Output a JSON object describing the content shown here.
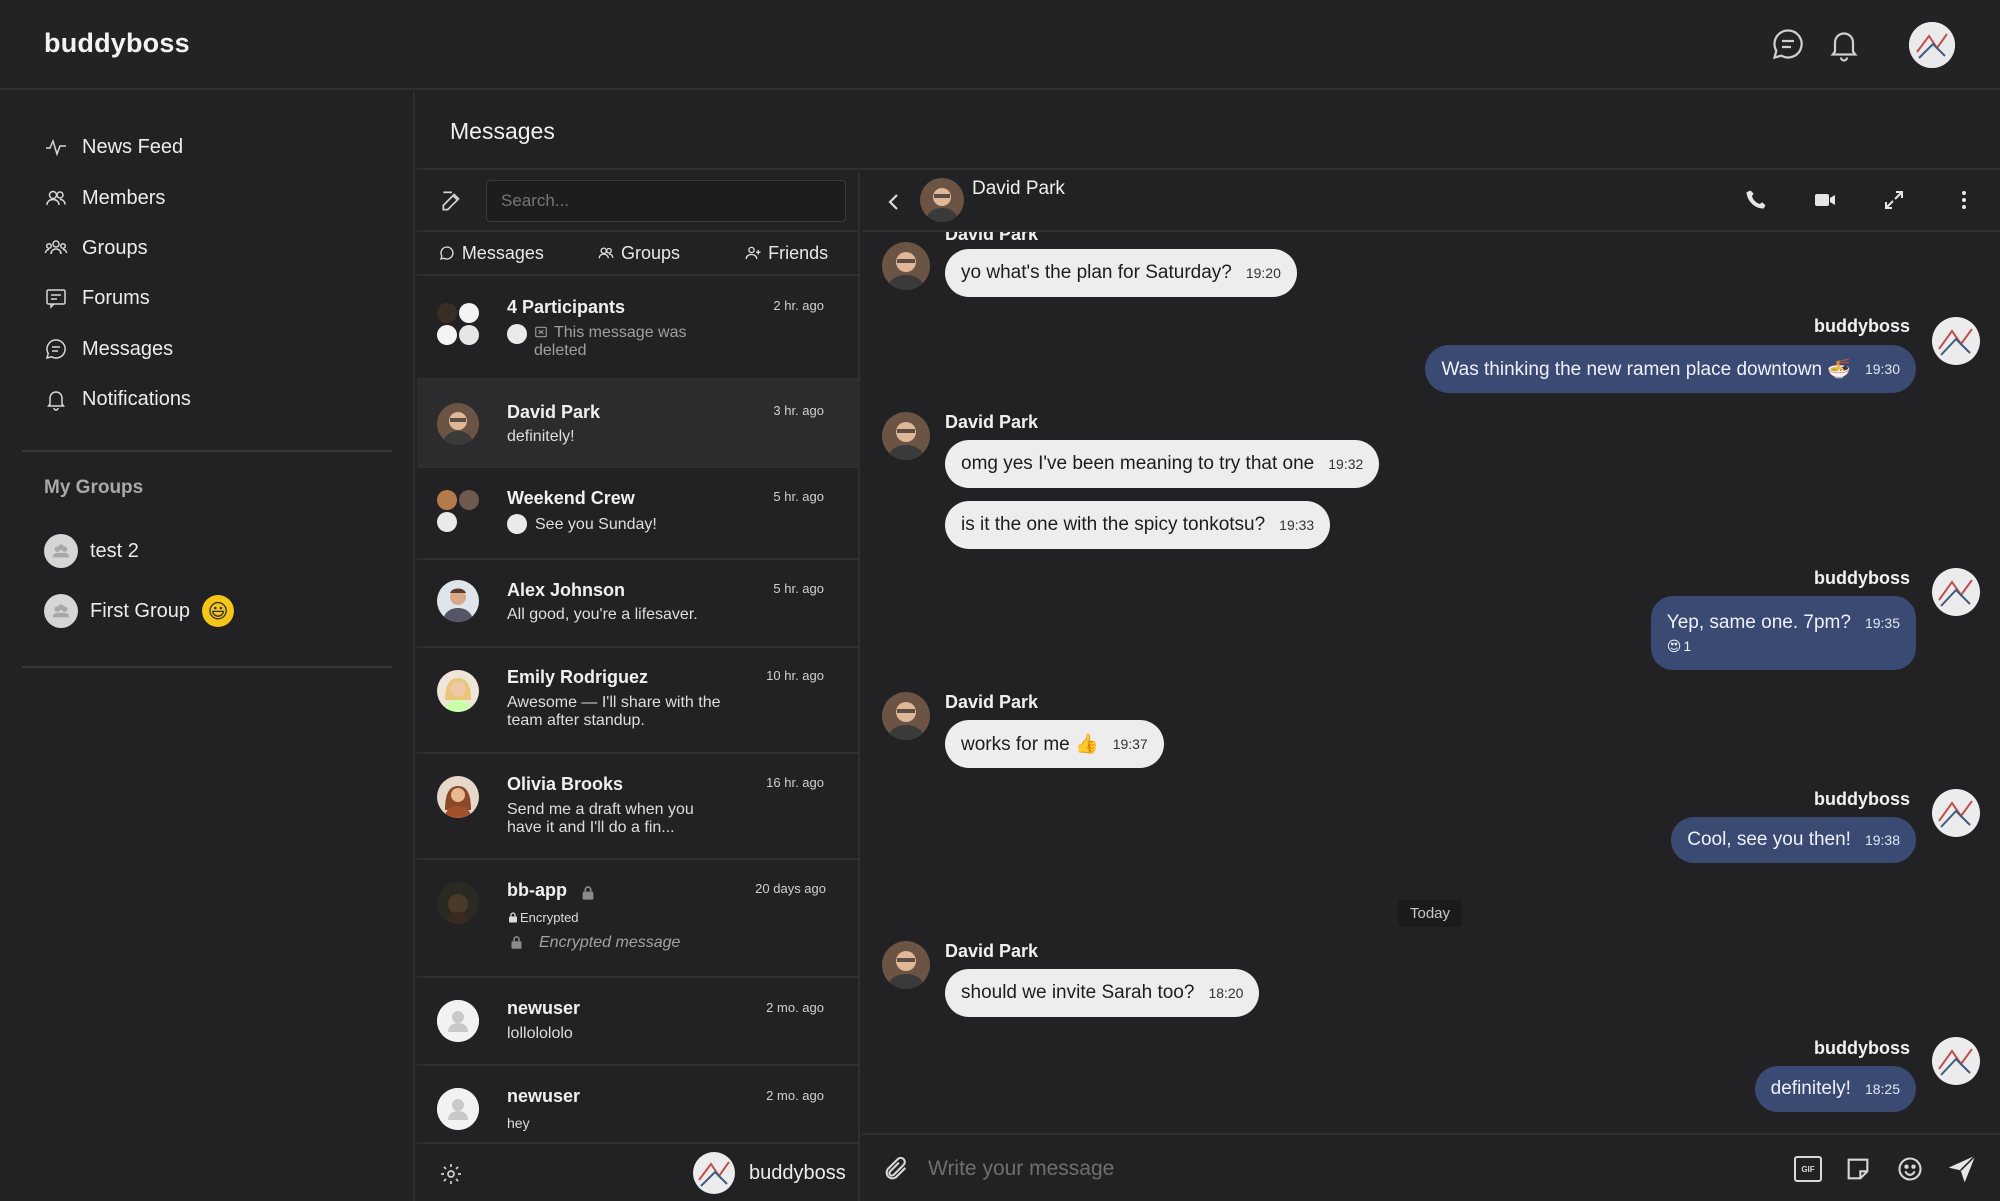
{
  "app": {
    "logo": "buddyboss"
  },
  "sidebar": {
    "items": [
      {
        "label": "News Feed",
        "icon": "activity-icon"
      },
      {
        "label": "Members",
        "icon": "members-icon"
      },
      {
        "label": "Groups",
        "icon": "groups-icon"
      },
      {
        "label": "Forums",
        "icon": "forums-icon"
      },
      {
        "label": "Messages",
        "icon": "messages-icon"
      },
      {
        "label": "Notifications",
        "icon": "bell-icon"
      }
    ],
    "my_groups_heading": "My Groups",
    "groups": [
      {
        "label": "test 2"
      },
      {
        "label": "First Group",
        "emoji": "😃"
      }
    ]
  },
  "messages": {
    "title": "Messages",
    "search_placeholder": "Search...",
    "tabs": [
      {
        "label": "Messages",
        "icon": "chat-bubble-icon"
      },
      {
        "label": "Groups",
        "icon": "groups-icon"
      },
      {
        "label": "Friends",
        "icon": "friends-icon"
      }
    ],
    "threads": [
      {
        "name": "4 Participants",
        "time": "2 hr. ago",
        "preview": "This message was deleted"
      },
      {
        "name": "David Park",
        "time": "3 hr. ago",
        "preview": "definitely!"
      },
      {
        "name": "Weekend Crew",
        "time": "5 hr. ago",
        "preview": "See you Sunday!"
      },
      {
        "name": "Alex Johnson",
        "time": "5 hr. ago",
        "preview": "All good, you're a lifesaver."
      },
      {
        "name": "Emily Rodriguez",
        "time": "10 hr. ago",
        "preview": "Awesome — I'll share with the team after standup."
      },
      {
        "name": "Olivia Brooks",
        "time": "16 hr. ago",
        "preview": "Send me a draft when you have it and I'll do a fin..."
      },
      {
        "name": "bb-app",
        "time": "20 days ago",
        "badge": "Encrypted",
        "preview": "Encrypted message"
      },
      {
        "name": "newuser",
        "time": "2 mo. ago",
        "preview": "lollolololo"
      },
      {
        "name": "newuser",
        "time": "2 mo. ago",
        "preview": "hey"
      }
    ],
    "footer_user": "buddyboss"
  },
  "chat": {
    "contact_name": "David Park",
    "partial_sender": "David Park",
    "today_label": "Today",
    "composer_placeholder": "Write your message",
    "gif_label": "GIF",
    "messages": [
      {
        "sender": "David Park",
        "text": "yo what's the plan for Saturday?",
        "time": "19:20"
      },
      {
        "sender": "buddyboss",
        "text": "Was thinking the new ramen place downtown 🍜",
        "time": "19:30"
      },
      {
        "sender": "David Park",
        "text": "omg yes I've been meaning to try that one",
        "time": "19:32"
      },
      {
        "sender": "",
        "text": "is it the one with the spicy tonkotsu?",
        "time": "19:33"
      },
      {
        "sender": "buddyboss",
        "text": "Yep, same one. 7pm?",
        "time": "19:35",
        "reaction": "😍",
        "reaction_count": "1"
      },
      {
        "sender": "David Park",
        "text": "works for me 👍",
        "time": "19:37"
      },
      {
        "sender": "buddyboss",
        "text": "Cool, see you then!",
        "time": "19:38"
      },
      {
        "sender": "David Park",
        "text": "should we invite Sarah too?",
        "time": "18:20"
      },
      {
        "sender": "buddyboss",
        "text": "definitely!",
        "time": "18:25"
      }
    ]
  },
  "colors": {
    "background": "#222224",
    "outgoing_bubble": "#3b4a72",
    "incoming_bubble": "#ededed",
    "divider": "#2f2f31"
  }
}
